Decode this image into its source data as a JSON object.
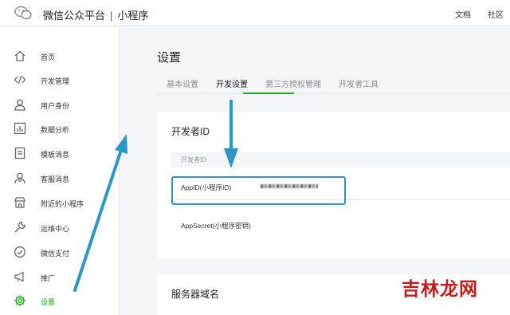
{
  "header": {
    "brand_main": "微信公众平台",
    "brand_sep": "|",
    "brand_sub": "小程序",
    "links": [
      "文档",
      "社区"
    ]
  },
  "sidebar": {
    "items": [
      {
        "label": "首页",
        "icon": "home-icon"
      },
      {
        "label": "开发管理",
        "icon": "code-icon"
      },
      {
        "label": "用户身份",
        "icon": "user-icon"
      },
      {
        "label": "数据分析",
        "icon": "chart-icon"
      },
      {
        "label": "模板消息",
        "icon": "document-icon"
      },
      {
        "label": "客服消息",
        "icon": "service-icon"
      },
      {
        "label": "附近的小程序",
        "icon": "store-icon"
      },
      {
        "label": "运维中心",
        "icon": "wrench-icon"
      },
      {
        "label": "微信支付",
        "icon": "pay-icon"
      },
      {
        "label": "推广",
        "icon": "megaphone-icon"
      },
      {
        "label": "设置",
        "icon": "gear-icon",
        "active": true
      }
    ]
  },
  "main": {
    "title": "设置",
    "tabs": [
      {
        "label": "基本设置"
      },
      {
        "label": "开发设置",
        "active": true
      },
      {
        "label": "第三方授权管理"
      },
      {
        "label": "开发者工具"
      }
    ],
    "developer_card": {
      "title": "开发者ID",
      "table_header": "开发者ID",
      "rows": [
        {
          "label": "AppID(小程序ID)"
        },
        {
          "label": "AppSecret(小程序密钥)"
        }
      ]
    },
    "server_card": {
      "title": "服务器域名"
    }
  },
  "colors": {
    "accent": "#1aad19",
    "highlight": "#2a97c9",
    "watermark": "#c41a1a"
  },
  "watermark": "吉林龙网"
}
